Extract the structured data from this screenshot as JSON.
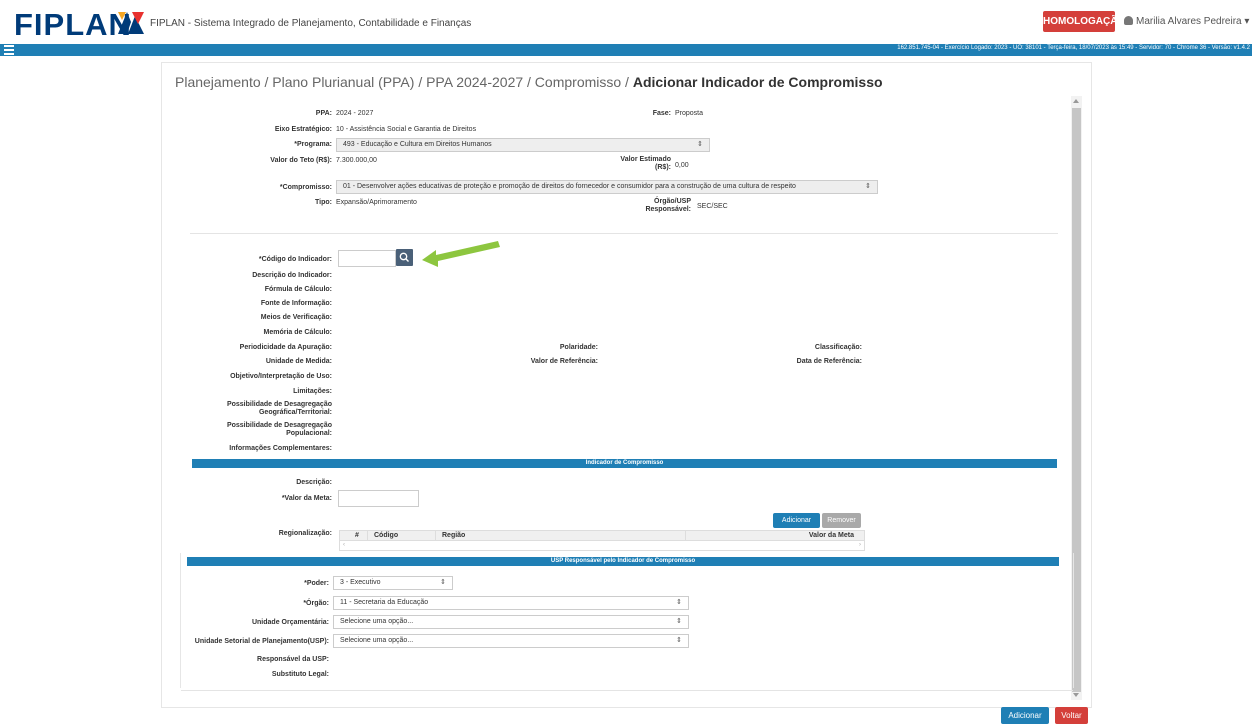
{
  "header": {
    "logo_text": "FIPLAN",
    "system_title": "FIPLAN - Sistema Integrado de Planejamento, Contabilidade e Finanças",
    "env_badge": "HOMOLOGAÇÃO",
    "user_name": "Marilia Alvares Pedreira",
    "info_line": "162.851.745-04 - Exercício Logado: 2023 - UO: 38101 - Terça-feira, 18/07/2023 às 15:49 - Servidor: 70 - Chrome 36 - Versão: v1.4.2"
  },
  "breadcrumb": {
    "path": "Planejamento / Plano Plurianual (PPA) / PPA 2024-2027 / Compromisso / ",
    "current": "Adicionar Indicador de Compromisso"
  },
  "form_top": {
    "ppa_label": "PPA:",
    "ppa_value": "2024 - 2027",
    "fase_label": "Fase:",
    "fase_value": "Proposta",
    "eixo_label": "Eixo Estratégico:",
    "eixo_value": "10 - Assistência Social e Garantia de Direitos",
    "programa_label": "*Programa:",
    "programa_value": "493 - Educação e Cultura em Direitos Humanos",
    "teto_label": "Valor do Teto (R$):",
    "teto_value": "7.300.000,00",
    "estimado_label_1": "Valor Estimado",
    "estimado_label_2": "(R$):",
    "estimado_value": "0,00",
    "compromisso_label": "*Compromisso:",
    "compromisso_value": "01 - Desenvolver ações educativas de proteção e promoção de direitos do fornecedor e consumidor para a construção de uma cultura de respeito",
    "tipo_label": "Tipo:",
    "tipo_value": "Expansão/Aprimoramento",
    "orgao_usp_label_1": "Órgão/USP",
    "orgao_usp_label_2": "Responsável:",
    "orgao_usp_value": "SEC/SEC"
  },
  "indicator": {
    "codigo_label": "*Código do Indicador:",
    "descricao_label": "Descrição do Indicador:",
    "formula_label": "Fórmula de Cálculo:",
    "fonte_label": "Fonte de Informação:",
    "meios_label": "Meios de Verificação:",
    "memoria_label": "Memória de Cálculo:",
    "periodicidade_label": "Periodicidade da Apuração:",
    "polaridade_label": "Polaridade:",
    "classificacao_label": "Classificação:",
    "unidade_label": "Unidade de Medida:",
    "valor_ref_label": "Valor de Referência:",
    "data_ref_label": "Data de Referência:",
    "objetivo_label": "Objetivo/Interpretação de Uso:",
    "limitacoes_label": "Limitações:",
    "geo_label_1": "Possibilidade de Desagregação",
    "geo_label_2": "Geográfica/Territorial:",
    "pop_label_1": "Possibilidade de Desagregação",
    "pop_label_2": "Populacional:",
    "info_label": "Informações Complementares:"
  },
  "compromisso_section": {
    "title": "Indicador de Compromisso",
    "descricao_label": "Descrição:",
    "meta_label": "*Valor da Meta:",
    "regionalizacao_label": "Regionalização:",
    "add_button": "Adicionar",
    "remove_button": "Remover",
    "columns": [
      "#",
      "Código",
      "Região",
      "Valor da Meta"
    ]
  },
  "usp_section": {
    "title": "USP Responsável pelo Indicador de Compromisso",
    "poder_label": "*Poder:",
    "poder_value": "3 - Executivo",
    "orgao_label": "*Órgão:",
    "orgao_value": "11 - Secretaria da Educação",
    "uo_label": "Unidade Orçamentária:",
    "uo_value": "Selecione uma opção...",
    "usp_label": "Unidade Setorial de Planejamento(USP):",
    "usp_value": "Selecione uma opção...",
    "responsavel_label": "Responsável da USP:",
    "substituto_label": "Substituto Legal:"
  },
  "footer": {
    "add_button": "Adicionar",
    "back_button": "Voltar"
  },
  "colors": {
    "brand_blue": "#1f7fb5",
    "badge_red": "#d43f3a",
    "arrow_green": "#8dc63f"
  }
}
